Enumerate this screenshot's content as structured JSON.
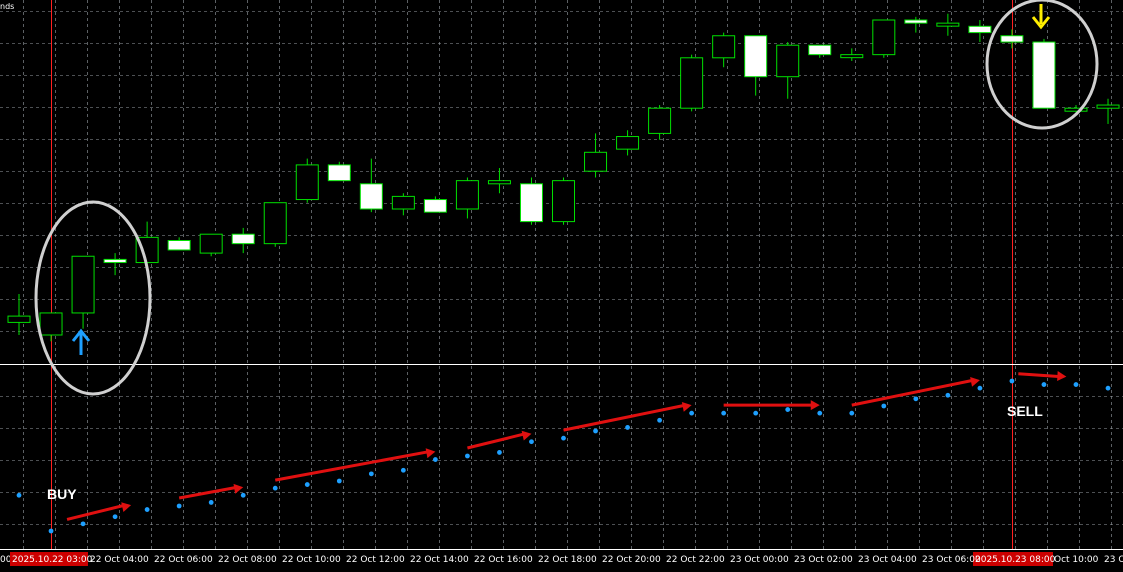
{
  "window": {
    "title_fragment": "nds"
  },
  "colors": {
    "background": "#000000",
    "grid": "#9aa0a6",
    "candle_outline": "#00e000",
    "bull_body": "#000000",
    "bear_body": "#ffffff",
    "separator": "#ffffff",
    "vline": "#ff2020",
    "indicator_dot": "#1ea0ff",
    "arrow_red": "#e01010",
    "arrow_up": "#1ea0ff",
    "arrow_down": "#ffee00",
    "circle": "#d0d0d0",
    "time_label_highlight": "#cc0000"
  },
  "annotations": {
    "buy_label": "BUY",
    "sell_label": "SELL"
  },
  "time_axis": {
    "left_clip": "00",
    "labels": [
      "22 Oct 04:00",
      "22 Oct 06:00",
      "22 Oct 08:00",
      "22 Oct 10:00",
      "22 Oct 12:00",
      "22 Oct 14:00",
      "22 Oct 16:00",
      "22 Oct 18:00",
      "22 Oct 20:00",
      "22 Oct 22:00",
      "23 Oct 00:00",
      "23 Oct 02:00",
      "23 Oct 04:00",
      "23 Oct 06:00",
      "Oct 10:00",
      "23 Oc"
    ],
    "highlight_left": "2025.10.22 03:00",
    "highlight_right": "2025.10.23 08:00"
  },
  "chart_data": {
    "type": "candlestick",
    "note_direction": "bear = filled white body (close below open), bull = hollow body",
    "candles": [
      {
        "o": 7.4,
        "h": 8.3,
        "l": 7.0,
        "c": 7.6
      },
      {
        "o": 7.0,
        "h": 7.6,
        "l": 6.8,
        "c": 7.7
      },
      {
        "o": 7.7,
        "h": 9.5,
        "l": 7.2,
        "c": 9.5
      },
      {
        "o": 9.4,
        "h": 9.6,
        "l": 8.9,
        "c": 9.3
      },
      {
        "o": 9.3,
        "h": 10.6,
        "l": 9.1,
        "c": 10.1
      },
      {
        "o": 10.0,
        "h": 10.1,
        "l": 9.7,
        "c": 9.7
      },
      {
        "o": 9.6,
        "h": 10.2,
        "l": 9.5,
        "c": 10.2
      },
      {
        "o": 10.2,
        "h": 10.4,
        "l": 9.6,
        "c": 9.9
      },
      {
        "o": 9.9,
        "h": 11.2,
        "l": 9.8,
        "c": 11.2
      },
      {
        "o": 11.3,
        "h": 12.6,
        "l": 11.2,
        "c": 12.4
      },
      {
        "o": 12.4,
        "h": 12.5,
        "l": 11.9,
        "c": 11.9
      },
      {
        "o": 11.8,
        "h": 12.6,
        "l": 10.9,
        "c": 11.0
      },
      {
        "o": 11.0,
        "h": 11.5,
        "l": 10.8,
        "c": 11.4
      },
      {
        "o": 11.3,
        "h": 11.4,
        "l": 10.9,
        "c": 10.9
      },
      {
        "o": 11.0,
        "h": 12.0,
        "l": 10.7,
        "c": 11.9
      },
      {
        "o": 11.8,
        "h": 12.3,
        "l": 11.5,
        "c": 11.9
      },
      {
        "o": 11.8,
        "h": 12.0,
        "l": 10.5,
        "c": 10.6
      },
      {
        "o": 10.6,
        "h": 12.0,
        "l": 10.5,
        "c": 11.9
      },
      {
        "o": 12.2,
        "h": 13.4,
        "l": 12.0,
        "c": 12.8
      },
      {
        "o": 12.9,
        "h": 13.5,
        "l": 12.7,
        "c": 13.3
      },
      {
        "o": 13.4,
        "h": 14.3,
        "l": 13.2,
        "c": 14.2
      },
      {
        "o": 14.2,
        "h": 15.9,
        "l": 14.1,
        "c": 15.8
      },
      {
        "o": 15.8,
        "h": 16.6,
        "l": 15.5,
        "c": 16.5
      },
      {
        "o": 16.5,
        "h": 16.5,
        "l": 14.6,
        "c": 15.2
      },
      {
        "o": 15.2,
        "h": 16.3,
        "l": 14.5,
        "c": 16.2
      },
      {
        "o": 16.2,
        "h": 16.2,
        "l": 15.8,
        "c": 15.9
      },
      {
        "o": 15.9,
        "h": 16.1,
        "l": 15.7,
        "c": 15.9
      },
      {
        "o": 15.9,
        "h": 17.0,
        "l": 15.8,
        "c": 17.0
      },
      {
        "o": 17.0,
        "h": 17.1,
        "l": 16.6,
        "c": 16.9
      },
      {
        "o": 16.9,
        "h": 17.2,
        "l": 16.5,
        "c": 16.9
      },
      {
        "o": 16.8,
        "h": 17.0,
        "l": 16.3,
        "c": 16.6
      },
      {
        "o": 16.5,
        "h": 16.7,
        "l": 16.1,
        "c": 16.3
      },
      {
        "o": 16.3,
        "h": 16.4,
        "l": 14.2,
        "c": 14.2
      },
      {
        "o": 14.2,
        "h": 14.3,
        "l": 14.0,
        "c": 14.2
      },
      {
        "o": 14.2,
        "h": 14.5,
        "l": 13.7,
        "c": 14.3
      }
    ],
    "indicator_dots": [
      1.0,
      0.0,
      0.2,
      0.4,
      0.6,
      0.7,
      0.8,
      1.0,
      1.2,
      1.3,
      1.4,
      1.6,
      1.7,
      2.0,
      2.1,
      2.2,
      2.5,
      2.6,
      2.8,
      2.9,
      3.1,
      3.3,
      3.3,
      3.3,
      3.4,
      3.3,
      3.3,
      3.5,
      3.7,
      3.8,
      4.0,
      4.2,
      4.1,
      4.1,
      4.0
    ],
    "buy_bar_index": 2,
    "sell_bar_index": 31
  }
}
